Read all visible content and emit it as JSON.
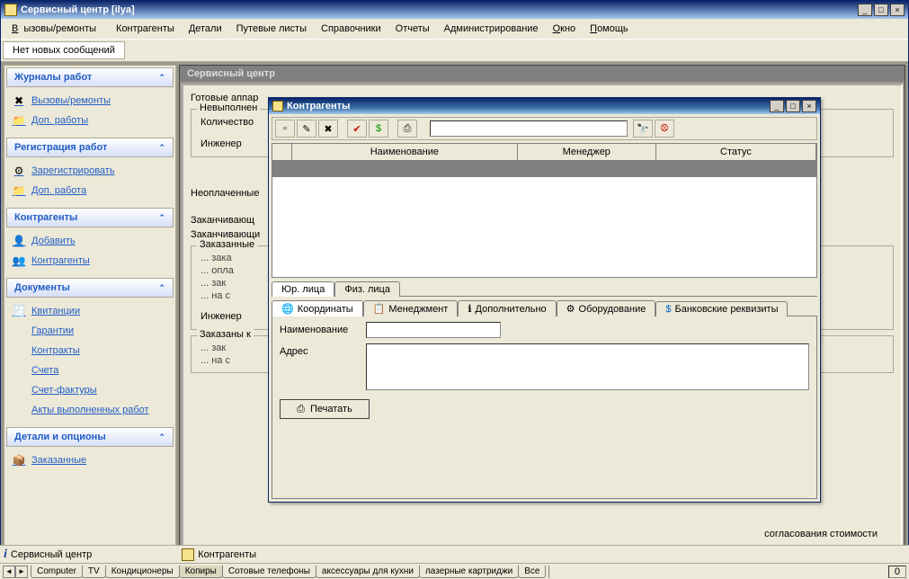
{
  "app": {
    "title": "Сервисный центр [ilya]"
  },
  "menu": {
    "calls": "Вызовы/ремонты",
    "contr": "Контрагенты",
    "parts": "Детали",
    "routes": "Путевые листы",
    "refs": "Справочники",
    "reports": "Отчеты",
    "admin": "Администрирование",
    "window": "Окно",
    "help": "Помощь"
  },
  "notif": "Нет новых сообщений",
  "sidebar": {
    "g1": {
      "title": "Журналы работ",
      "i1": "Вызовы/ремонты",
      "i2": "Доп. работы"
    },
    "g2": {
      "title": "Регистрация работ",
      "i1": "Зарегистрировать",
      "i2": "Доп. работа"
    },
    "g3": {
      "title": "Контрагенты",
      "i1": "Добавить",
      "i2": "Контрагенты"
    },
    "g4": {
      "title": "Документы",
      "i1": "Квитанции",
      "i2": "Гарантии",
      "i3": "Контракты",
      "i4": "Счета",
      "i5": "Счет-фактуры",
      "i6": "Акты выполненных работ"
    },
    "g5": {
      "title": "Детали и опционы",
      "i1": "Заказанные"
    }
  },
  "mdi": {
    "title": "Сервисный центр",
    "ready": "Готовые аппар",
    "unfilled_legend": "Невыполнен",
    "qty": "Количество",
    "engineer": "Инженер",
    "unpaid": "Неоплаченные",
    "endingK": "Заканчивающ",
    "endingI": "Заканчивающи",
    "ordered_legend": "Заказанные",
    "d_zak": "... зака",
    "d_opl": "... опла",
    "d_zak2": "... зак",
    "d_nas": "... на с",
    "engineer2": "Инженер",
    "ordered_k": "Заказаны к",
    "d_zak3": "... зак",
    "d_nas2": "... на с",
    "back_peek": "согласования стоимости"
  },
  "child": {
    "title": "Контрагенты",
    "grid": {
      "c1": "Наименование",
      "c2": "Менеджер",
      "c3": "Статус"
    },
    "tabs_top": {
      "t1": "Юр. лица",
      "t2": "Физ. лица"
    },
    "tabs_mid": {
      "t1": "Координаты",
      "t2": "Менеджмент",
      "t3": "Дополнительно",
      "t4": "Оборудование",
      "t5": "Банковские реквизиты"
    },
    "lbl_name": "Наименование",
    "lbl_addr": "Адрес",
    "print": "Печатать"
  },
  "status": {
    "s1": "Сервисный центр",
    "s2": "Контрагенты"
  },
  "btabs": {
    "t1": "Computer",
    "t2": "TV",
    "t3": "Кондиционеры",
    "t4": "Копиры",
    "t5": "Сотовые телефоны",
    "t6": "аксессуары для кухни",
    "t7": "лазерные картриджи",
    "t8": "Все",
    "zero": "0"
  }
}
